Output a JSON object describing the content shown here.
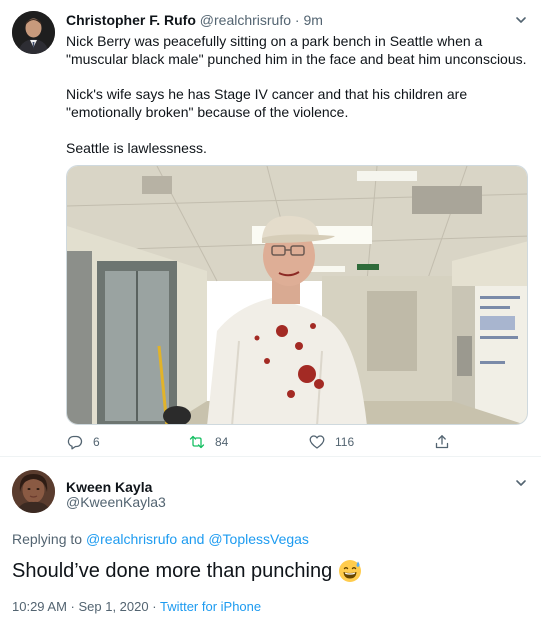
{
  "parent_tweet": {
    "author_name": "Christopher F. Rufo",
    "author_handle": "@realchrisrufo",
    "separator": "·",
    "time": "9m",
    "paragraphs": [
      "Nick Berry was peacefully sitting on a park bench in Seattle when a \"muscular black male\" punched him in the face and beat him unconscious.",
      "Nick's wife says he has Stage IV cancer and that his children are \"emotionally broken\" because of the violence.",
      "Seattle is lawlessness."
    ],
    "actions": {
      "replies": "6",
      "retweets": "84",
      "likes": "116"
    },
    "action_colors": {
      "retweet": "#17bf63",
      "default": "#536471"
    }
  },
  "reply_tweet": {
    "author_name": "Kween Kayla",
    "author_handle": "@KweenKayla3",
    "replying_prefix": "Replying to",
    "replying_to_1": "@realchrisrufo",
    "replying_and": "and",
    "replying_to_2": "@ToplessVegas",
    "text": "Should’ve done more than punching",
    "emoji": "grinning-face-with-sweat-emoji",
    "timestamp": "10:29 AM · Sep 1, 2020",
    "meta_separator": "·",
    "source": "Twitter for iPhone"
  },
  "colors": {
    "accent": "#1d9bf0",
    "secondary_text": "#536471",
    "primary_text": "#0f1419"
  }
}
